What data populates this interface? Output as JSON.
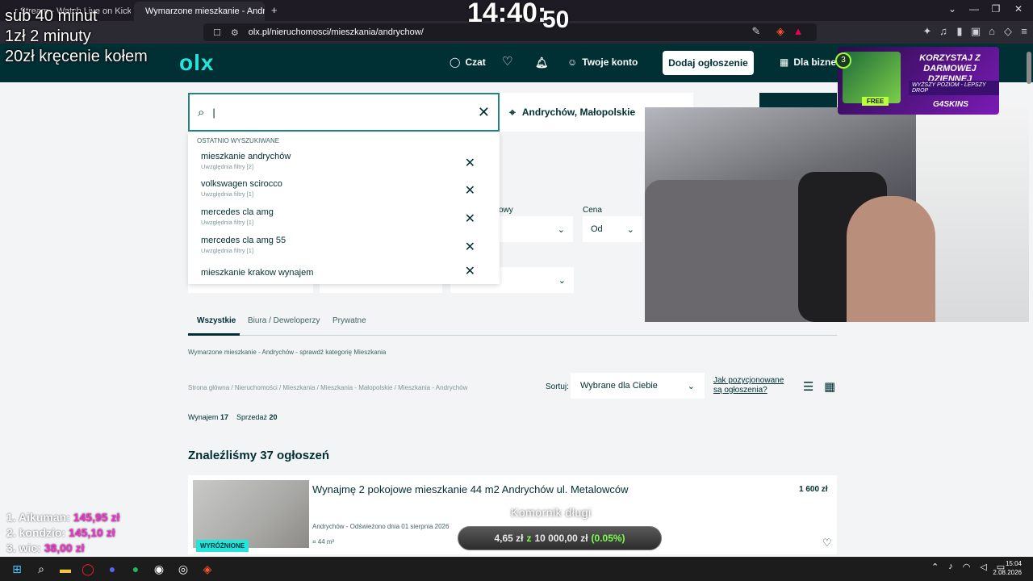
{
  "browser": {
    "tabs": [
      {
        "title": "r Stream - Watch Live on Kick",
        "active": false
      },
      {
        "title": "Wymarzone mieszkanie - Andryc",
        "active": true
      }
    ],
    "url": "olx.pl/nieruchomosci/mieszkania/andrychow/"
  },
  "olx": {
    "logo": "olx",
    "nav": {
      "chat": "Czat",
      "account": "Twoje konto",
      "post": "Dodaj ogłoszenie",
      "business": "Dla bizne"
    },
    "search": {
      "value": "|",
      "location": "Andrychów, Małopolskie"
    },
    "recent": {
      "header": "OSTATNIO WYSZUKIWANE",
      "items": [
        {
          "query": "mieszkanie andrychów",
          "filters": "Uwzględnia filtry [2]"
        },
        {
          "query": "volkswagen scirocco",
          "filters": "Uwzględnia filtry [1]"
        },
        {
          "query": "mercedes cla amg",
          "filters": "Uwzględnia filtry [1]"
        },
        {
          "query": "mercedes cla amg 55",
          "filters": "Uwzględnia filtry [1]"
        },
        {
          "query": "mieszkanie krakow wynajem",
          "filters": ""
        }
      ]
    },
    "filters": {
      "partial_label": "owy",
      "price_label": "Cena",
      "price_from": "Od"
    },
    "tabs": [
      "Wszystkie",
      "Biura / Deweloperzy",
      "Prywatne"
    ],
    "category_link": "Wymarzone mieszkanie - Andrychów - sprawdź kategorię Mieszkania",
    "breadcrumbs": "Strona główna / Nieruchomości / Mieszkania / Mieszkania - Małopolskie / Mieszkania - Andrychów",
    "sort": {
      "label": "Sortuj:",
      "value": "Wybrane dla Ciebie",
      "how": "Jak pozycjonowane są ogłoszenia?"
    },
    "counts": {
      "rent_label": "Wynajem",
      "rent": "17",
      "sale_label": "Sprzedaż",
      "sale": "20"
    },
    "found": "Znaleźliśmy 37 ogłoszeń",
    "listing": {
      "title": "Wynajmę 2 pokojowe mieszkanie 44 m2 Andrychów ul. Metalowców",
      "price": "1 600 zł",
      "location": "Andrychów - Odświeżono dnia 01 sierpnia 2026",
      "area": "44 m²",
      "badge": "WYRÓŻNIONE"
    }
  },
  "ad": {
    "headline": "KORZYSTAJ Z DARMOWEJ DZIENNEJ SKRZYNKI!",
    "sub": "WYŻSZY POZIOM - LEPSZY DROP",
    "free": "FREE",
    "brand": "G4SKINS",
    "level": "3"
  },
  "overlay": {
    "clock_main": "14:40:",
    "clock_tail": "50",
    "sub_lines": [
      "sub 40 minut",
      "1zł 2 minuty",
      "20zł kręcenie kołem"
    ],
    "donors": [
      {
        "name": "1. Aikuman:",
        "amount": "145,95 zł"
      },
      {
        "name": "2. kondzio:",
        "amount": "145,10 zł"
      },
      {
        "name": "3. wic:",
        "amount": "38,00 zł"
      }
    ],
    "goal_title": "Komornik długi",
    "goal_current": "4,65 zł",
    "goal_sep": "z",
    "goal_target": "10 000,00 zł",
    "goal_pct": "(0.05%)"
  },
  "taskbar": {
    "time": "15:04",
    "date": "2.08.2026"
  },
  "colors": {
    "olx_dark": "#002f34",
    "olx_accent": "#23e5db",
    "donor": "#ff2bd6",
    "goal_green": "#7cff4c"
  }
}
